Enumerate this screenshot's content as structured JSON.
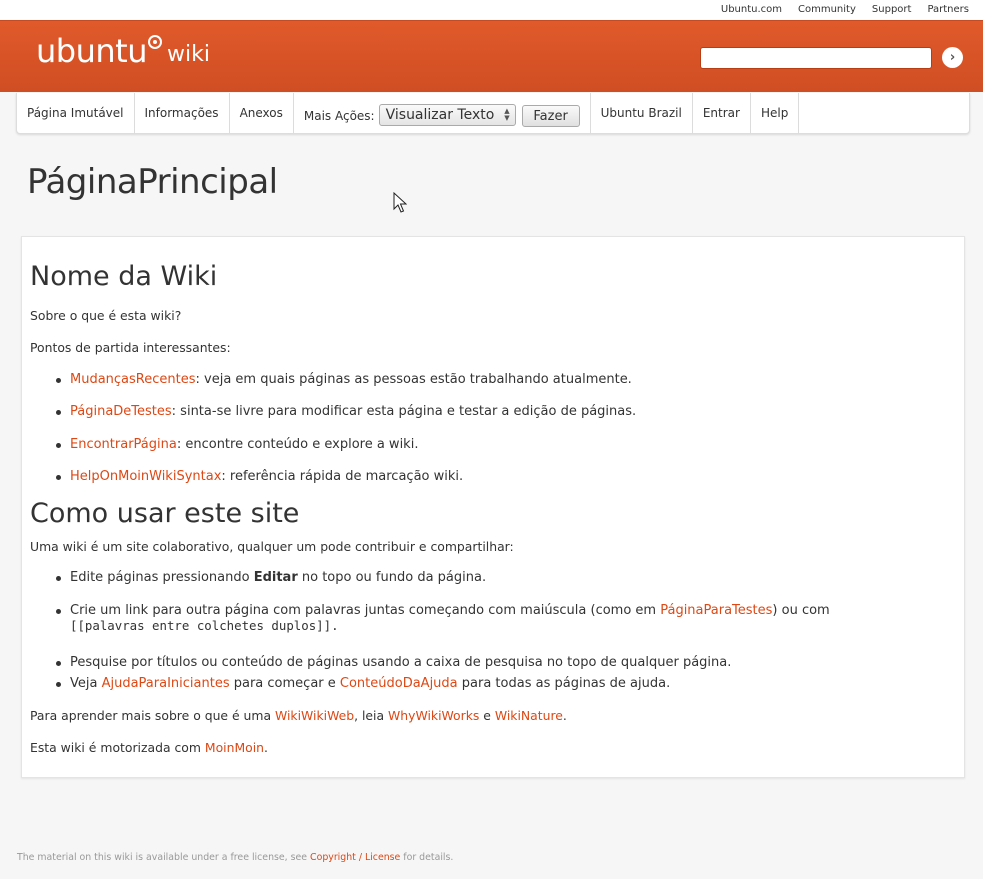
{
  "topbar": {
    "links": [
      "Ubuntu.com",
      "Community",
      "Support",
      "Partners"
    ]
  },
  "header": {
    "brand_main": "ubuntu",
    "brand_sub": "wiki",
    "search_value": "",
    "search_go": "›"
  },
  "nav": {
    "items_left": [
      "Página Imutável",
      "Informações",
      "Anexos"
    ],
    "more_actions_label": "Mais Ações:",
    "more_actions_selected": "Visualizar Texto",
    "do_button": "Fazer",
    "items_right": [
      "Ubuntu Brazil",
      "Entrar",
      "Help"
    ]
  },
  "page": {
    "title": "PáginaPrincipal"
  },
  "content": {
    "h1": "Nome da Wiki",
    "about": "Sobre o que é esta wiki?",
    "starting_points": "Pontos de partida interessantes:",
    "bullets1": [
      {
        "link": "MudançasRecentes",
        "text": ": veja em quais páginas as pessoas estão trabalhando atualmente."
      },
      {
        "link": "PáginaDeTestes",
        "text": ": sinta-se livre para modificar esta página e testar a edição de páginas."
      },
      {
        "link": "EncontrarPágina",
        "text": ": encontre conteúdo e explore a wiki."
      },
      {
        "link": "HelpOnMoinWikiSyntax",
        "text": ": referência rápida de marcação wiki."
      }
    ],
    "h2": "Como usar este site",
    "intro2": "Uma wiki é um site colaborativo, qualquer um pode contribuir e compartilhar:",
    "b2_1_pre": "Edite páginas pressionando ",
    "b2_1_bold": "Editar",
    "b2_1_post": " no topo ou fundo da página.",
    "b2_2_pre": "Crie um link para outra página com palavras juntas começando com maiúscula (como em ",
    "b2_2_link": "PáginaParaTestes",
    "b2_2_post": ") ou com",
    "b2_2_code": "[[palavras entre colchetes duplos]].",
    "b2_3": "Pesquise por títulos ou conteúdo de páginas usando a caixa de pesquisa no topo de qualquer página.",
    "b2_4_pre": "Veja ",
    "b2_4_link1": "AjudaParaIniciantes",
    "b2_4_mid": " para começar e ",
    "b2_4_link2": "ConteúdoDaAjuda",
    "b2_4_post": " para todas as páginas de ajuda.",
    "learn_pre": "Para aprender mais sobre o que é uma ",
    "learn_link1": "WikiWikiWeb",
    "learn_mid1": ", leia ",
    "learn_link2": "WhyWikiWorks",
    "learn_mid2": " e ",
    "learn_link3": "WikiNature",
    "learn_post": ".",
    "powered_pre": "Esta wiki é motorizada com ",
    "powered_link": "MoinMoin",
    "powered_post": "."
  },
  "footer": {
    "pre": "The material on this wiki is available under a free license, see ",
    "link": "Copyright / License",
    "post": " for details."
  }
}
